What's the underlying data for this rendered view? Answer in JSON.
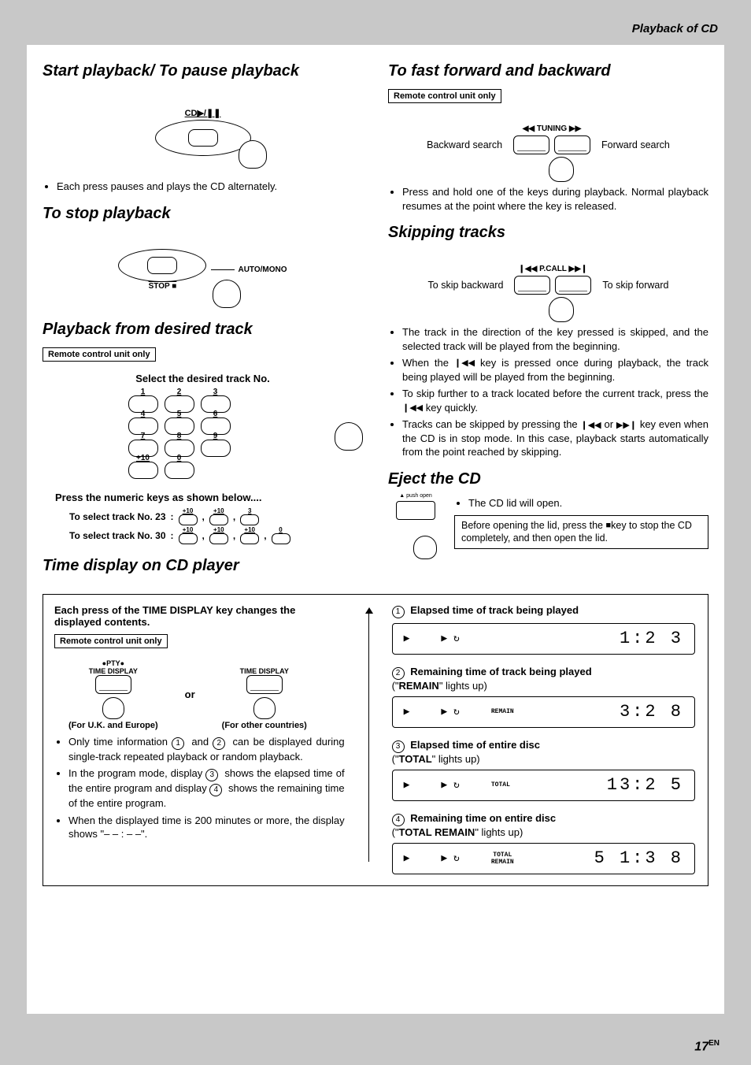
{
  "header": {
    "section_label": "Playback of CD"
  },
  "page_number": {
    "num": "17",
    "suffix": "EN"
  },
  "left": {
    "s1": {
      "title": "Start playback/ To pause playback",
      "button_label": "CD▶/❚❚",
      "bullet": "Each press pauses and plays the CD alternately."
    },
    "s2": {
      "title": "To stop playback",
      "right_label": "AUTO/MONO",
      "stop_label": "STOP ■"
    },
    "s3": {
      "title": "Playback from desired track",
      "remote_only": "Remote control unit only",
      "select_label": "Select the desired track No.",
      "keypad": [
        "1",
        "2",
        "3",
        "4",
        "5",
        "6",
        "7",
        "8",
        "9",
        "+10",
        "0"
      ],
      "press_label": "Press the numeric keys as shown below....",
      "ex23_label": "To select track No. 23",
      "ex23_keys": [
        "+10",
        "+10",
        "3"
      ],
      "ex30_label": "To select track No. 30",
      "ex30_keys": [
        "+10",
        "+10",
        "+10",
        "0"
      ]
    },
    "s4": {
      "title": "Time display on CD player"
    }
  },
  "right": {
    "s1": {
      "title": "To fast forward and backward",
      "remote_only": "Remote control unit only",
      "back_label": "Backward search",
      "fwd_label": "Forward search",
      "tuning_label": "◀◀ TUNING ▶▶",
      "bullet": "Press and hold one of the keys during playback. Normal playback resumes at the point where the key is released."
    },
    "s2": {
      "title": "Skipping tracks",
      "back_label": "To skip backward",
      "fwd_label": "To skip forward",
      "pcall_label": "❙◀◀ P.CALL ▶▶❙",
      "b1": "The track in the direction of the key pressed is skipped, and the selected track will be played from the beginning.",
      "b2_a": "When the ",
      "b2_b": " key is pressed once during playback, the track being played will be played from the beginning.",
      "b3_a": "To skip further to a track located before the current track, press the ",
      "b3_b": " key quickly.",
      "b4_a": "Tracks can be skipped by pressing the ",
      "b4_mid": " or ",
      "b4_b": " key even when the CD is in stop mode. In this case, playback starts automatically from the point reached by skipping."
    },
    "s3": {
      "title": "Eject the CD",
      "push_open": "▲ push open",
      "bullet": "The CD lid will open.",
      "note_a": "Before opening the lid, press the ",
      "note_b": "key to stop the CD completely, and then open the lid."
    }
  },
  "timebox": {
    "heading": "Each press of the TIME DISPLAY key changes the displayed contents.",
    "remote_only": "Remote control unit only",
    "pty": "●PTY●",
    "td_label": "TIME DISPLAY",
    "or": "or",
    "cap_uk": "(For U.K. and Europe)",
    "cap_other": "(For other countries)",
    "n1_a": "Only time information ",
    "n1_b": " and ",
    "n1_c": " can be displayed during single-track repeated playback or random playback.",
    "n2_a": "In the program mode, display ",
    "n2_b": " shows the elapsed time of the entire program and display ",
    "n2_c": " shows the remaining time of the entire program.",
    "n3": "When the displayed time is 200 minutes or more, the display shows \"– – : – –\".",
    "items": [
      {
        "num": "1",
        "title": "Elapsed time of track being played",
        "sub": "",
        "indicator": "",
        "time": "1:2 3"
      },
      {
        "num": "2",
        "title": "Remaining time of track being played",
        "sub_a": "(\"",
        "sub_b": "REMAIN",
        "sub_c": "\" lights up)",
        "indicator": "REMAIN",
        "time": "3:2 8"
      },
      {
        "num": "3",
        "title": "Elapsed time of entire disc",
        "sub_a": "(\"",
        "sub_b": "TOTAL",
        "sub_c": "\" lights up)",
        "indicator": "TOTAL",
        "time": "13:2 5"
      },
      {
        "num": "4",
        "title": "Remaining time on entire disc",
        "sub_a": "(\"",
        "sub_b": "TOTAL REMAIN",
        "sub_c": "\" lights up)",
        "indicator": "TOTAL\nREMAIN",
        "time": "5 1:3 8"
      }
    ]
  }
}
